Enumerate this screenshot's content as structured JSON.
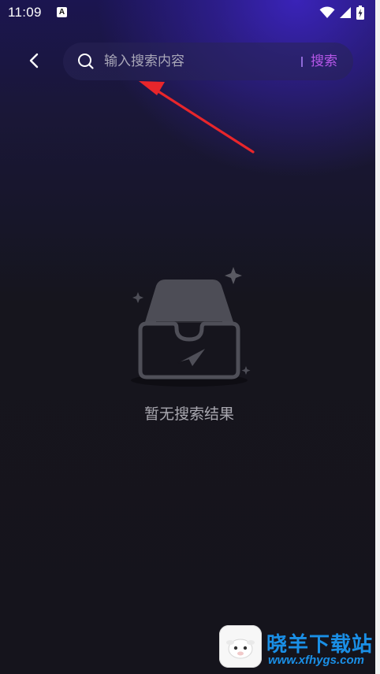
{
  "status_bar": {
    "time": "11:09",
    "notification_icon_letter": "A",
    "icons": [
      "wifi-icon",
      "signal-icon",
      "battery-icon"
    ]
  },
  "search": {
    "placeholder": "输入搜索内容",
    "value": "",
    "submit_label": "搜索",
    "accent_color": "#b657e8"
  },
  "empty_state": {
    "message": "暂无搜索结果",
    "icon": "empty-inbox-icon"
  },
  "watermark": {
    "name": "晓羊下载站",
    "url": "www.xfhygs.com"
  }
}
